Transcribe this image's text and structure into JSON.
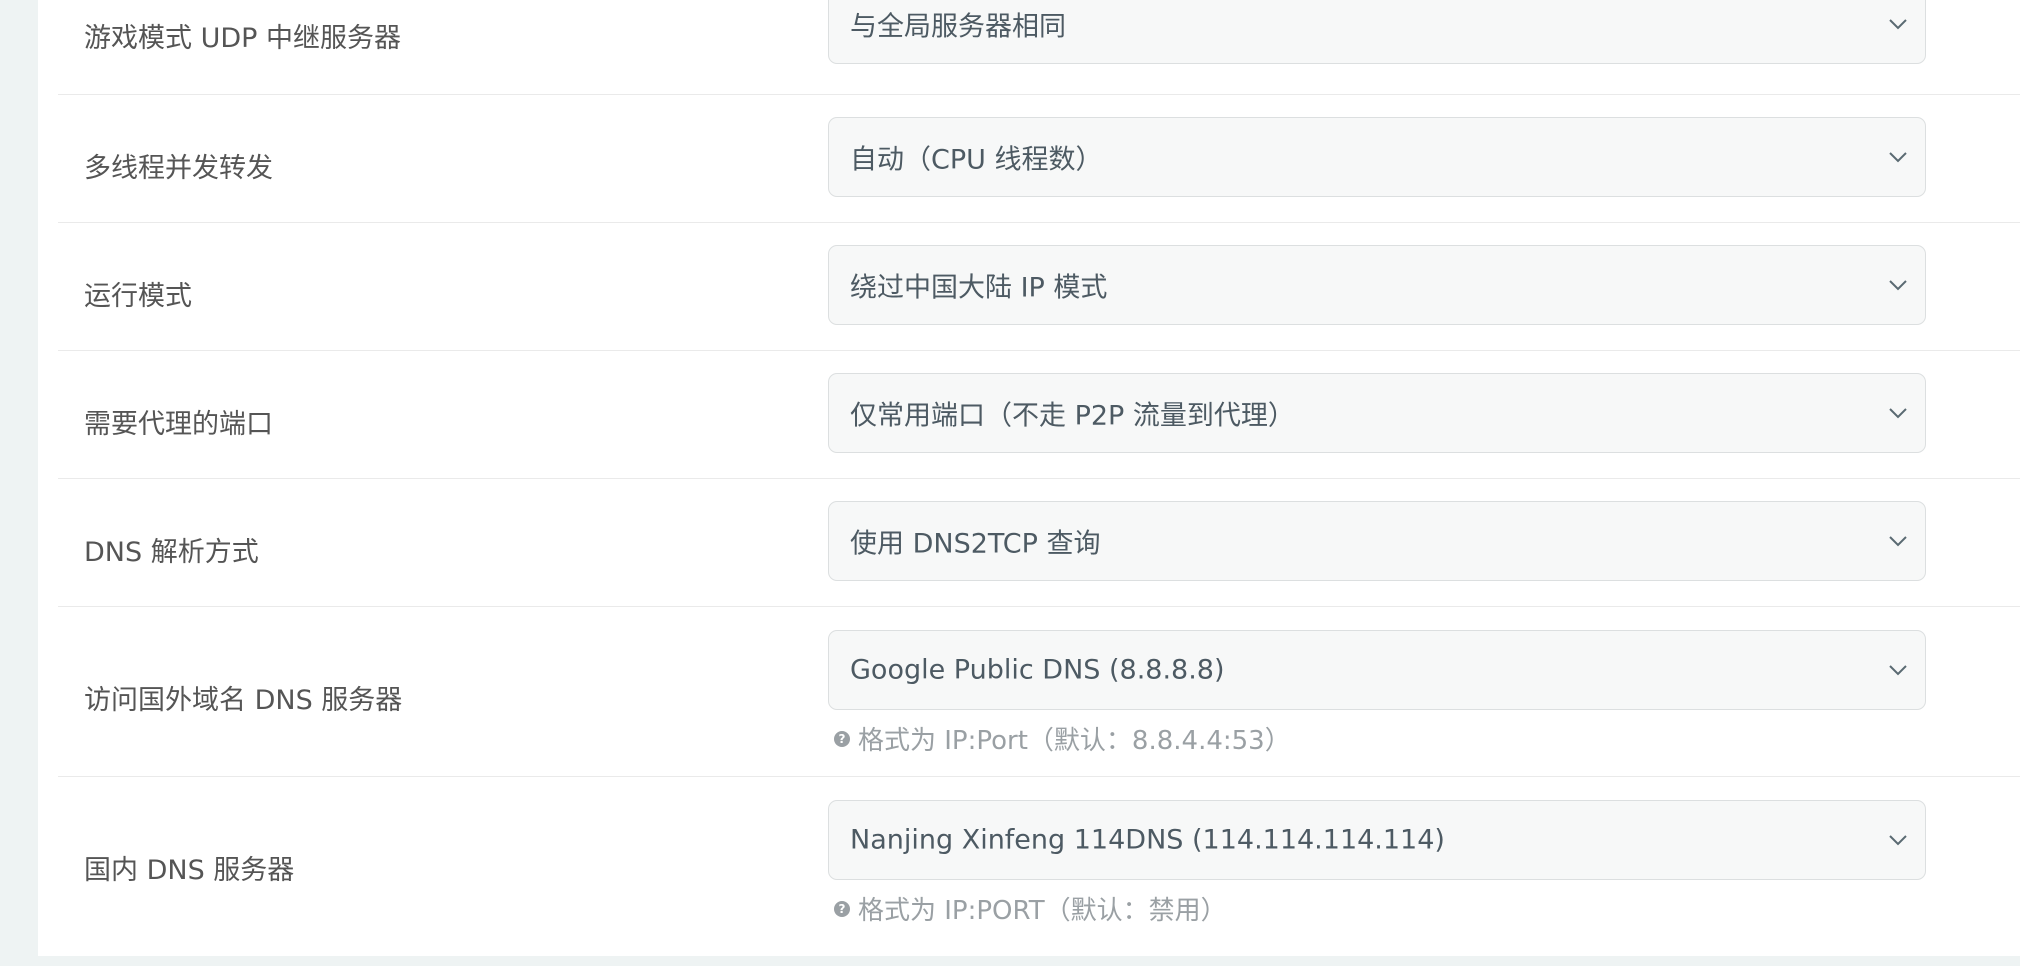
{
  "settings": {
    "rows": [
      {
        "label": "游戏模式 UDP 中继服务器",
        "value": "与全局服务器相同"
      },
      {
        "label": "多线程并发转发",
        "value": "自动（CPU 线程数）"
      },
      {
        "label": "运行模式",
        "value": "绕过中国大陆 IP 模式"
      },
      {
        "label": "需要代理的端口",
        "value": "仅常用端口（不走 P2P 流量到代理）"
      },
      {
        "label": "DNS 解析方式",
        "value": "使用 DNS2TCP 查询"
      },
      {
        "label": "访问国外域名 DNS 服务器",
        "value": "Google Public DNS (8.8.8.8)",
        "help": "格式为 IP:Port（默认：8.8.4.4:53）"
      },
      {
        "label": "国内 DNS 服务器",
        "value": "Nanjing Xinfeng 114DNS (114.114.114.114)",
        "help": "格式为 IP:PORT（默认：禁用）"
      }
    ]
  },
  "icons": {
    "dropdown": "chevron-down-icon",
    "help": "question-circle-icon"
  },
  "colors": {
    "page_background": "#eef3f3",
    "panel_background": "#ffffff",
    "select_background": "#f7f8f8",
    "select_border": "#dcdfe0",
    "label_text": "#555555",
    "value_text": "#4d5a63",
    "help_text": "#9aa0a4"
  }
}
